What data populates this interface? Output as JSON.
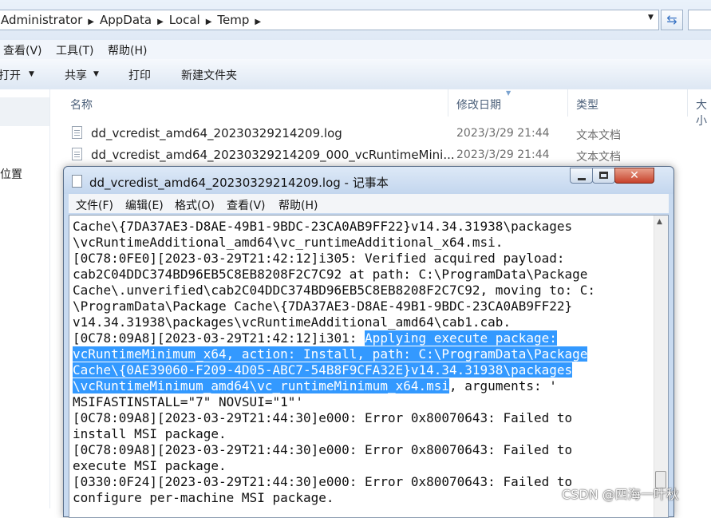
{
  "explorer": {
    "breadcrumb": [
      "Administrator",
      "AppData",
      "Local",
      "Temp"
    ],
    "menu": [
      "查看(V)",
      "工具(T)",
      "帮助(H)"
    ],
    "toolbar": {
      "open": "打开",
      "share": "共享",
      "print": "打印",
      "new_folder": "新建文件夹"
    },
    "nav_location": "位置",
    "columns": {
      "name": "名称",
      "date": "修改日期",
      "type": "类型",
      "size": "大小"
    },
    "files": [
      {
        "name": "dd_vcredist_amd64_20230329214209.log",
        "date": "2023/3/29 21:44",
        "type": "文本文档"
      },
      {
        "name": "dd_vcredist_amd64_20230329214209_000_vcRuntimeMini...",
        "date": "2023/3/29 21:44",
        "type": "文本文档"
      }
    ]
  },
  "notepad": {
    "title": "dd_vcredist_amd64_20230329214209.log - 记事本",
    "menu": [
      "文件(F)",
      "编辑(E)",
      "格式(O)",
      "查看(V)",
      "帮助(H)"
    ],
    "lines_before": "Cache\\{7DA37AE3-D8AE-49B1-9BDC-23CA0AB9FF22}v14.34.31938\\packages\n\\vcRuntimeAdditional_amd64\\vc_runtimeAdditional_x64.msi.\n[0C78:0FE0][2023-03-29T21:42:12]i305: Verified acquired payload:\ncab2C04DDC374BD96EB5C8EB8208F2C7C92 at path: C:\\ProgramData\\Package\nCache\\.unverified\\cab2C04DDC374BD96EB5C8EB8208F2C7C92, moving to: C:\n\\ProgramData\\Package Cache\\{7DA37AE3-D8AE-49B1-9BDC-23CA0AB9FF22}\nv14.34.31938\\packages\\vcRuntimeAdditional_amd64\\cab1.cab.\n[0C78:09A8][2023-03-29T21:42:12]i301: ",
    "selected_text": "Applying execute package:\nvcRuntimeMinimum_x64, action: Install, path: C:\\ProgramData\\Package\nCache\\{0AE39060-F209-4D05-ABC7-54B8F9CFA32E}v14.34.31938\\packages\n\\vcRuntimeMinimum_amd64\\vc_runtimeMinimum_x64.msi",
    "lines_after": ", arguments: '\nMSIFASTINSTALL=\"7\" NOVSUI=\"1\"'\n[0C78:09A8][2023-03-29T21:44:30]e000: Error 0x80070643: Failed to\ninstall MSI package.\n[0C78:09A8][2023-03-29T21:44:30]e000: Error 0x80070643: Failed to\nexecute MSI package.\n[0330:0F24][2023-03-29T21:44:30]e000: Error 0x80070643: Failed to\nconfigure per-machine MSI package."
  },
  "watermark": "CSDN @四海一叶秋",
  "colors": {
    "selection": "#3399ff",
    "close_button": "#c7422b"
  }
}
